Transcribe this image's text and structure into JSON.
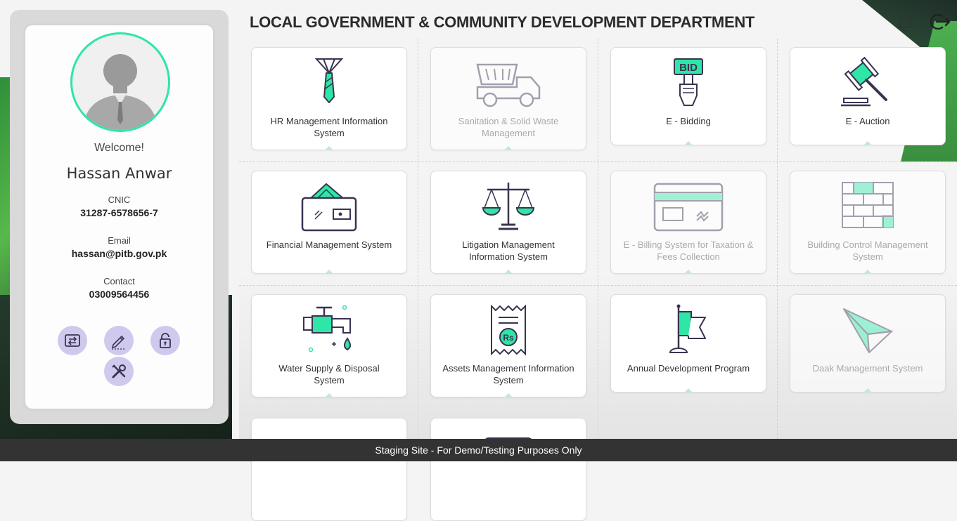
{
  "header": {
    "title": "LOCAL GOVERNMENT & COMMUNITY DEVELOPMENT DEPARTMENT",
    "icons": [
      "bell-icon",
      "logout-icon"
    ]
  },
  "profile": {
    "welcome": "Welcome!",
    "name": "Hassan Anwar",
    "cnic_label": "CNIC",
    "cnic": "31287-6578656-7",
    "email_label": "Email",
    "email": "hassan@pitb.gov.pk",
    "contact_label": "Contact",
    "contact": "03009564456",
    "actions": [
      "switch-icon",
      "edit-icon",
      "lock-icon",
      "tools-icon"
    ]
  },
  "tiles": [
    {
      "label": "HR Management Information System",
      "icon": "necktie-icon",
      "enabled": true
    },
    {
      "label": "Sanitation & Solid Waste Management",
      "icon": "dump-truck-icon",
      "enabled": false
    },
    {
      "label": "E - Bidding",
      "icon": "bid-sign-icon",
      "enabled": true
    },
    {
      "label": "E - Auction",
      "icon": "gavel-icon",
      "enabled": true
    },
    {
      "label": "Financial Management System",
      "icon": "wallet-icon",
      "enabled": true
    },
    {
      "label": "Litigation Management Information System",
      "icon": "scales-icon",
      "enabled": true
    },
    {
      "label": "E - Billing System for Taxation & Fees Collection",
      "icon": "card-icon",
      "enabled": false
    },
    {
      "label": "Building Control Management System",
      "icon": "bricks-icon",
      "enabled": false
    },
    {
      "label": "Water Supply & Disposal System",
      "icon": "faucet-icon",
      "enabled": true
    },
    {
      "label": "Assets Management Information System",
      "icon": "receipt-icon",
      "enabled": true
    },
    {
      "label": "Annual Development Program",
      "icon": "flag-icon",
      "enabled": true
    },
    {
      "label": "Daak Management System",
      "icon": "paper-plane-icon",
      "enabled": false
    }
  ],
  "colors": {
    "accent": "#2ee6a6",
    "ink": "#3a3350",
    "footer": "#333333",
    "action_bg": "#cfc9ee"
  },
  "footer": {
    "text": "Staging Site - For Demo/Testing Purposes Only"
  }
}
